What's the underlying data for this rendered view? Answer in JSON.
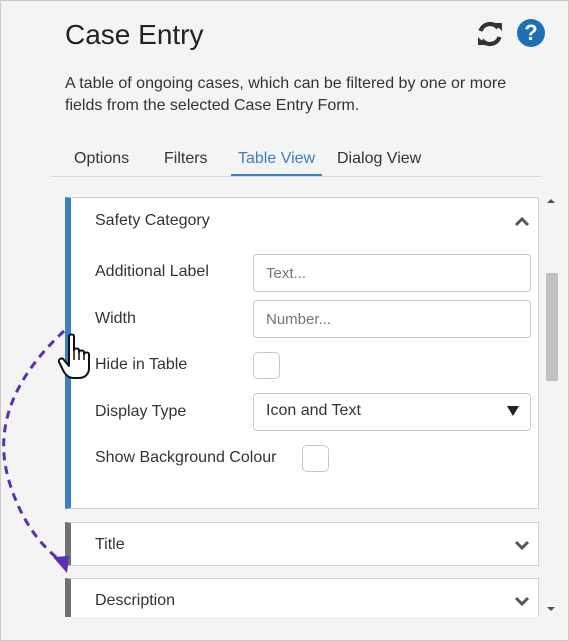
{
  "header": {
    "title": "Case Entry",
    "description": "A table of ongoing cases, which can be filtered by one or more fields from the selected Case Entry Form."
  },
  "tabs": [
    {
      "label": "Options",
      "active": false
    },
    {
      "label": "Filters",
      "active": false
    },
    {
      "label": "Table View",
      "active": true
    },
    {
      "label": "Dialog View",
      "active": false
    }
  ],
  "sections": {
    "open": {
      "title": "Safety Category",
      "additional_label": {
        "label": "Additional Label",
        "placeholder": "Text..."
      },
      "width": {
        "label": "Width",
        "placeholder": "Number..."
      },
      "hide_in_table": {
        "label": "Hide in Table",
        "checked": false
      },
      "display_type": {
        "label": "Display Type",
        "value": "Icon and Text"
      },
      "show_background": {
        "label": "Show Background Colour",
        "checked": false
      }
    },
    "collapsed": [
      {
        "title": "Title"
      },
      {
        "title": "Description"
      }
    ]
  },
  "icons": {
    "refresh": "refresh-icon",
    "help": "help-icon",
    "chevron_up": "chevron-up-icon",
    "chevron_down": "chevron-down-icon",
    "cursor": "hand-pointer-cursor",
    "drag_arrow": "dashed-curved-arrow"
  },
  "colors": {
    "accent": "#3c7fc2",
    "help": "#1f6fb5",
    "collapsed_bar": "#707070",
    "arrow": "#5b2fb0"
  }
}
